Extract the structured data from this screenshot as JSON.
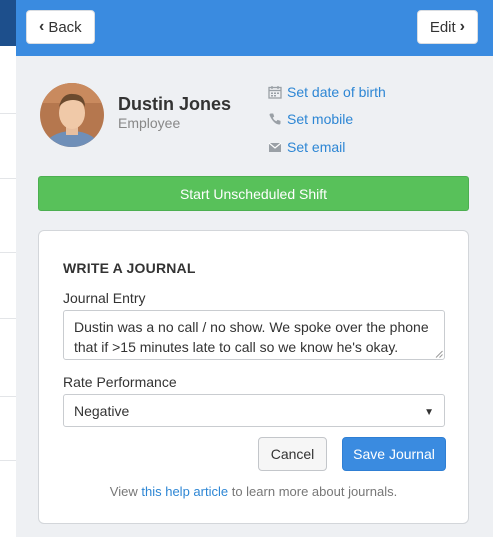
{
  "header": {
    "back_label": "Back",
    "edit_label": "Edit",
    "accent_color": "#3a8be0"
  },
  "profile": {
    "name": "Dustin Jones",
    "role": "Employee",
    "links": {
      "birth": "Set date of birth",
      "mobile": "Set mobile",
      "email": "Set email"
    }
  },
  "actions": {
    "start_shift_label": "Start Unscheduled Shift",
    "start_shift_color": "#58c15a"
  },
  "journal": {
    "title": "WRITE A JOURNAL",
    "entry_label": "Journal Entry",
    "entry_value": "Dustin was a no call / no show. We spoke over the phone that if >15 minutes late to call so we know he's okay.",
    "rate_label": "Rate Performance",
    "rate_value": "Negative",
    "cancel_label": "Cancel",
    "save_label": "Save Journal",
    "help_prefix": "View",
    "help_link": "this help article",
    "help_suffix": "to learn more about journals."
  },
  "icons": {
    "back": "chevron-left-icon",
    "edit": "chevron-right-icon",
    "birth": "calendar-icon",
    "mobile": "phone-icon",
    "email": "envelope-icon",
    "select": "caret-down-icon"
  }
}
